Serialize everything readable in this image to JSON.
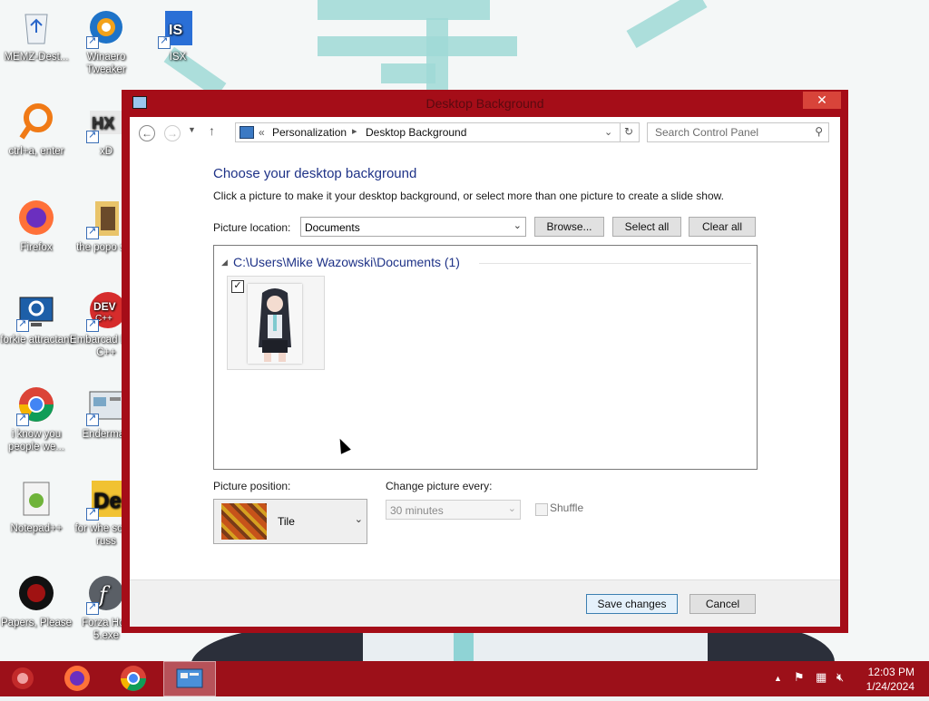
{
  "window": {
    "title": "Desktop Background"
  },
  "address": {
    "separator": "«",
    "crumbs": [
      "Personalization",
      "Desktop Background"
    ],
    "search_placeholder": "Search Control Panel"
  },
  "content": {
    "heading": "Choose your desktop background",
    "subtext": "Click a picture to make it your desktop background, or select more than one picture to create a slide show.",
    "picture_location_label": "Picture location:",
    "picture_location_value": "Documents",
    "browse_label": "Browse...",
    "select_all_label": "Select all",
    "clear_all_label": "Clear all",
    "group_header": "C:\\Users\\Mike Wazowski\\Documents (1)",
    "picture_position_label": "Picture position:",
    "picture_position_value": "Tile",
    "change_every_label": "Change picture every:",
    "change_every_value": "30 minutes",
    "shuffle_label": "Shuffle"
  },
  "footer": {
    "save_label": "Save changes",
    "cancel_label": "Cancel"
  },
  "desktop_icons": [
    {
      "label": "MEMZ-Dest...",
      "icon": "recycle-bin-icon"
    },
    {
      "label": "Winaero Tweaker",
      "icon": "winaero-icon"
    },
    {
      "label": "ISX",
      "icon": "isx-file-icon"
    },
    {
      "label": "ctrl+a, enter",
      "icon": "magnifier-icon"
    },
    {
      "label": "xD",
      "icon": "hxd-icon"
    },
    {
      "label": "Firefox",
      "icon": "firefox-icon"
    },
    {
      "label": "the popo shit",
      "icon": "folder-icon"
    },
    {
      "label": "forkie attractant",
      "icon": "settings-monitor-icon"
    },
    {
      "label": "Embarcad Dev-C++",
      "icon": "devcpp-icon"
    },
    {
      "label": "i know you people we...",
      "icon": "chrome-icon"
    },
    {
      "label": "Enderman",
      "icon": "enderman-icon"
    },
    {
      "label": "Notepad++",
      "icon": "notepadpp-icon"
    },
    {
      "label": "for whe some russ",
      "icon": "de-icon"
    },
    {
      "label": "Papers, Please",
      "icon": "papers-please-icon"
    },
    {
      "label": "Forza Hori 5.exe",
      "icon": "flash-icon"
    }
  ],
  "taskbar": {
    "time": "12:03 PM",
    "date": "1/24/2024"
  },
  "colors": {
    "window_border": "#a50d18",
    "taskbar": "#9c1019",
    "heading": "#1e3287"
  }
}
